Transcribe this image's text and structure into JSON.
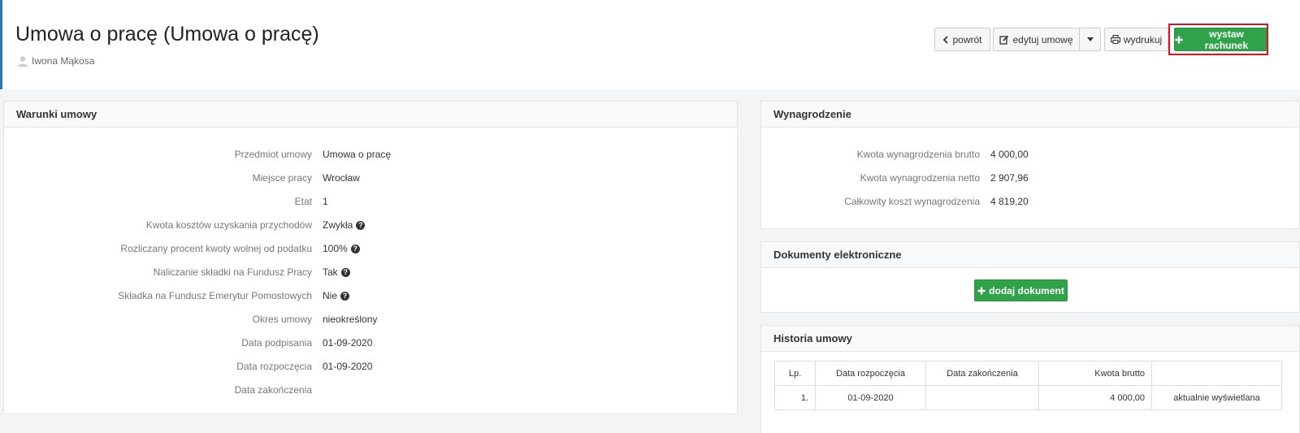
{
  "header": {
    "title": "Umowa o pracę (Umowa o pracę)",
    "user_name": "Iwona Mąkosa"
  },
  "toolbar": {
    "back_label": "powrót",
    "edit_label": "edytuj umowę",
    "print_label": "wydrukuj",
    "invoice_label": "wystaw rachunek"
  },
  "terms": {
    "title": "Warunki umowy",
    "rows": [
      {
        "label": "Przedmiot umowy",
        "value": "Umowa o pracę"
      },
      {
        "label": "Miejsce pracy",
        "value": "Wrocław"
      },
      {
        "label": "Etat",
        "value": "1"
      },
      {
        "label": "Kwota kosztów uzyskania przychodów",
        "value": "Zwykła"
      },
      {
        "label": "Rozliczany procent kwoty wolnej od podatku",
        "value": "100%"
      },
      {
        "label": "Naliczanie składki na Fundusz Pracy",
        "value": "Tak"
      },
      {
        "label": "Składka na Fundusz Emerytur Pomostowych",
        "value": "Nie"
      },
      {
        "label": "Okres umowy",
        "value": "nieokreślony"
      },
      {
        "label": "Data podpisania",
        "value": "01-09-2020"
      },
      {
        "label": "Data rozpoczęcia",
        "value": "01-09-2020"
      },
      {
        "label": "Data zakończenia",
        "value": ""
      }
    ]
  },
  "salary": {
    "title": "Wynagrodzenie",
    "rows": [
      {
        "label": "Kwota wynagrodzenia brutto",
        "value": "4 000,00"
      },
      {
        "label": "Kwota wynagrodzenia netto",
        "value": "2 907,96"
      },
      {
        "label": "Całkowity koszt wynagrodzenia",
        "value": "4 819,20"
      }
    ]
  },
  "documents": {
    "title": "Dokumenty elektroniczne",
    "add_label": "dodaj dokument"
  },
  "history": {
    "title": "Historia umowy",
    "columns": [
      "Lp.",
      "Data rozpoczęcia",
      "Data zakończenia",
      "Kwota brutto",
      ""
    ],
    "rows": [
      {
        "lp": "1.",
        "start": "01-09-2020",
        "end": "",
        "amount": "4 000,00",
        "status": "aktualnie wyświetlana"
      }
    ]
  }
}
